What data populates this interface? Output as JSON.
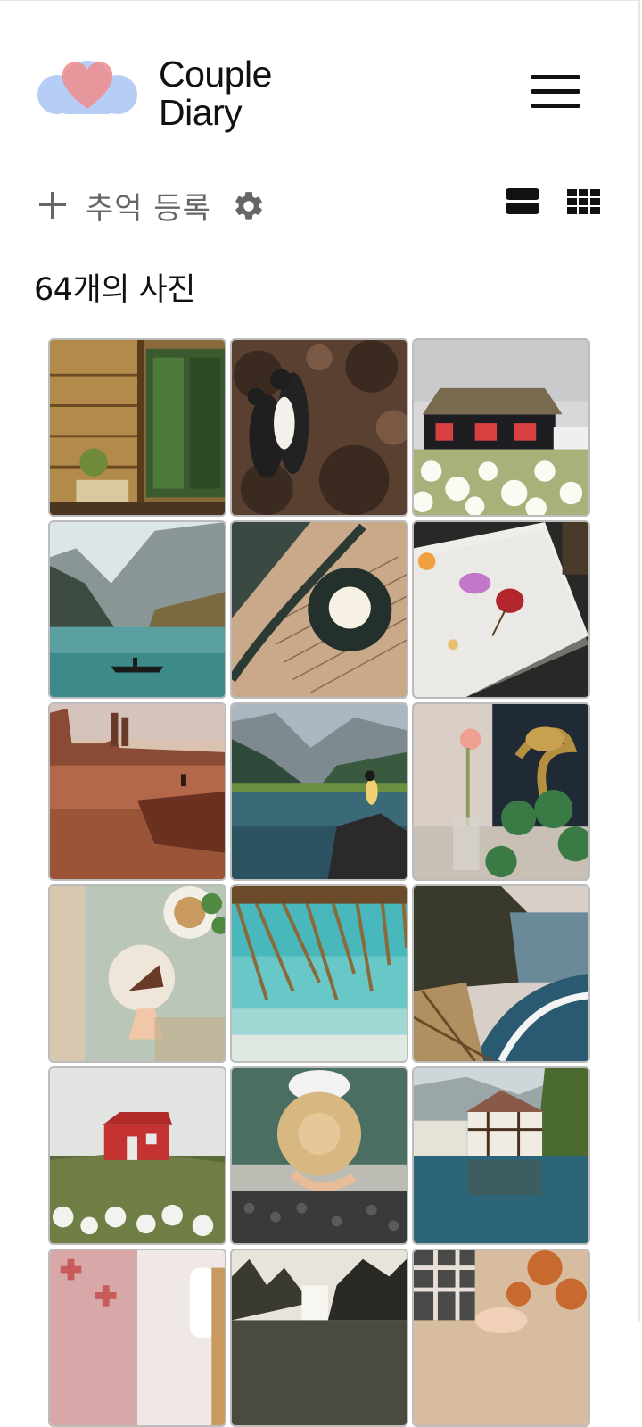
{
  "app": {
    "brand_line1": "Couple",
    "brand_line2": "Diary",
    "logo_icon": "heart-cloud-logo",
    "menu_icon": "hamburger-menu-icon"
  },
  "toolbar": {
    "add_label": "추억 등록",
    "add_icon": "plus-icon",
    "settings_icon": "gear-icon",
    "view_list_icon": "list-view-icon",
    "view_grid_icon": "grid-view-icon"
  },
  "gallery": {
    "count_label": "64개의 사진",
    "photos": [
      {
        "subject": "wooden cabin doorway with plants"
      },
      {
        "subject": "penguins on rocks"
      },
      {
        "subject": "house in daisy field"
      },
      {
        "subject": "mountain lake with boat"
      },
      {
        "subject": "coffee cup on book"
      },
      {
        "subject": "pressed flowers on paper"
      },
      {
        "subject": "desert canyon"
      },
      {
        "subject": "woman sitting on lake rock"
      },
      {
        "subject": "pink flowers and gold flamingo"
      },
      {
        "subject": "cake and coffee on table"
      },
      {
        "subject": "thatched umbrella over sea"
      },
      {
        "subject": "coastal cliffs and waves"
      },
      {
        "subject": "red house on hill"
      },
      {
        "subject": "straw hat in pool"
      },
      {
        "subject": "half-timbered houses by water"
      },
      {
        "subject": "pink pattern and vase"
      },
      {
        "subject": "waterfall in forest"
      },
      {
        "subject": "autumn leaves and hands"
      }
    ]
  },
  "colors": {
    "logo_cloud": "#b6cdf5",
    "logo_heart": "#f08c8c",
    "icon_gray": "#666666",
    "tile_border": "#bcbcbc"
  }
}
